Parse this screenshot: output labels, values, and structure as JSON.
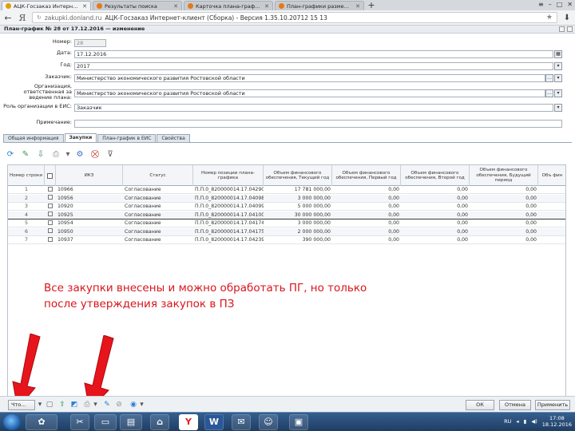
{
  "browser": {
    "tabs": [
      {
        "title": "АЦК-Госзаказ Интернет-клиент",
        "active": true
      },
      {
        "title": "Результаты поиска",
        "active": false
      },
      {
        "title": "Карточка плана-графика",
        "active": false
      },
      {
        "title": "План-графики размещен",
        "active": false
      }
    ],
    "new_tab_label": "+",
    "logo": "Я",
    "url": "zakupki.donland.ru",
    "page_title": "АЦК-Госзаказ Интернет-клиент (Сборка) - Версия 1.35.10.20712 15 13"
  },
  "document": {
    "title": "План-график № 28 от 17.12.2016 — изменение"
  },
  "form": {
    "number": {
      "label": "Номер:",
      "value": "28"
    },
    "date": {
      "label": "Дата:",
      "value": "17.12.2016"
    },
    "year": {
      "label": "Год:",
      "value": "2017"
    },
    "customer": {
      "label": "Заказчик:",
      "value": "Министерство экономического развития Ростовской области"
    },
    "organization": {
      "label": "Организация, ответственная за ведение плана:",
      "value": "Министерство экономического развития Ростовской области"
    },
    "role": {
      "label": "Роль организации в ЕИС:",
      "value": "Заказчик"
    },
    "note": {
      "label": "Примечание:",
      "value": ""
    }
  },
  "tabs": [
    "Общая информация",
    "Закупки",
    "План-график в ЕИС",
    "Свойства"
  ],
  "active_tab": "Закупки",
  "grid": {
    "columns": [
      "Номер строки",
      "",
      "ИКЗ",
      "Статус",
      "Номер позиции плана-графика",
      "Объем финансового обеспечения, Текущий год",
      "Объем финансового обеспечения, Первый год",
      "Объем финансового обеспечения, Второй год",
      "Объем финансового обеспечения, Будущий период",
      "Объ фин"
    ],
    "rows": [
      {
        "n": "1",
        "ikz": "10966",
        "status": "Согласование",
        "pos": "П.П.0_820000014.17.04290",
        "cur": "17 781 000,00",
        "y1": "0,00",
        "y2": "0,00",
        "fut": "0,00"
      },
      {
        "n": "2",
        "ikz": "10956",
        "status": "Согласование",
        "pos": "П.П.0_820000014.17.04098",
        "cur": "3 000 000,00",
        "y1": "0,00",
        "y2": "0,00",
        "fut": "0,00"
      },
      {
        "n": "3",
        "ikz": "10920",
        "status": "Согласование",
        "pos": "П.П.0_820000014.17.04099",
        "cur": "5 000 000,00",
        "y1": "0,00",
        "y2": "0,00",
        "fut": "0,00"
      },
      {
        "n": "4",
        "ikz": "10925",
        "status": "Согласование",
        "pos": "П.П.0_820000014.17.04100",
        "cur": "30 000 000,00",
        "y1": "0,00",
        "y2": "0,00",
        "fut": "0,00"
      },
      {
        "n": "5",
        "ikz": "10954",
        "status": "Согласование",
        "pos": "П.П.0_820000014.17.04174",
        "cur": "3 000 000,00",
        "y1": "0,00",
        "y2": "0,00",
        "fut": "0,00"
      },
      {
        "n": "6",
        "ikz": "10950",
        "status": "Согласование",
        "pos": "П.П.0_820000014.17.04175",
        "cur": "2 000 000,00",
        "y1": "0,00",
        "y2": "0,00",
        "fut": "0,00"
      },
      {
        "n": "7",
        "ikz": "10937",
        "status": "Согласование",
        "pos": "П.П.0_820000014.17.04239",
        "cur": "390 000,00",
        "y1": "0,00",
        "y2": "0,00",
        "fut": "0,00"
      }
    ]
  },
  "annotation": {
    "line1": "Все закупки внесены и можно обработать ПГ, но только",
    "line2": " после утверждения закупок в ПЗ"
  },
  "actions": {
    "dropdown": "Что...",
    "ok": "ОК",
    "cancel": "Отмена",
    "apply": "Применить"
  },
  "taskbar": {
    "lang": "RU",
    "time": "17:08",
    "date": "18.12.2016"
  },
  "colors": {
    "annotation_red": "#d8141c",
    "arrow_red": "#e8141c"
  }
}
